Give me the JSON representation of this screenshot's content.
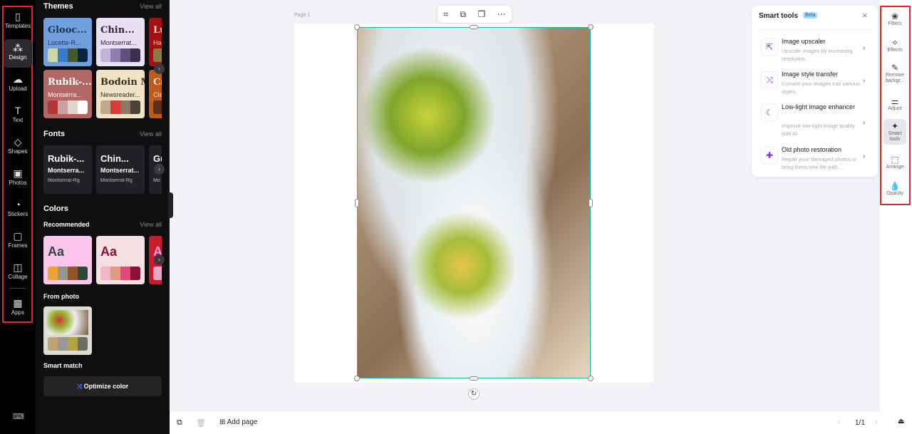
{
  "rail": {
    "items": [
      {
        "label": "Templates",
        "icon": "templates-icon"
      },
      {
        "label": "Design",
        "icon": "design-icon"
      },
      {
        "label": "Upload",
        "icon": "upload-icon"
      },
      {
        "label": "Text",
        "icon": "text-icon"
      },
      {
        "label": "Shapes",
        "icon": "shapes-icon"
      },
      {
        "label": "Photos",
        "icon": "photos-icon"
      },
      {
        "label": "Stickers",
        "icon": "stickers-icon"
      },
      {
        "label": "Frames",
        "icon": "frames-icon"
      },
      {
        "label": "Collage",
        "icon": "collage-icon"
      },
      {
        "label": "Apps",
        "icon": "apps-icon"
      }
    ],
    "selected": "Design"
  },
  "panel": {
    "themes": {
      "title": "Themes",
      "view_all": "View all",
      "cards": [
        {
          "t1": "Glooc...",
          "t2": "Lucette-R...",
          "bg": "#6fa0dd",
          "fg": "#1a3356",
          "colors": [
            "#cdd6a4",
            "#3a7acb",
            "#46592c",
            "#082441"
          ]
        },
        {
          "t1": "Chin...",
          "t2": "Montserrat...",
          "bg": "#e8e1f3",
          "fg": "#2e2543",
          "colors": [
            "#c0b4d8",
            "#8f7db0",
            "#5f4f7c",
            "#3a2f4e"
          ]
        },
        {
          "t1": "Lu",
          "t2": "Has",
          "bg": "#a50f12",
          "fg": "#f6d1c7",
          "colors": [
            "#8a7a44",
            "#a50f12",
            "#a50f12",
            "#a50f12"
          ]
        },
        {
          "t1": "Rubik-...",
          "t2": "Montserra...",
          "bg": "#b36866",
          "fg": "#fff",
          "colors": [
            "#b0363a",
            "#c9a2a2",
            "#e0d3d3",
            "#ffffff"
          ]
        },
        {
          "t1": "Bodoin Mo...",
          "t2": "Newsreader...",
          "bg": "#f1e3c5",
          "fg": "#3a2e25",
          "colors": [
            "#c4a68c",
            "#da3b3b",
            "#8b7763",
            "#4a4137"
          ]
        },
        {
          "t1": "Ca",
          "t2": "Cle",
          "bg": "#bd5a1c",
          "fg": "#f6d9c2",
          "colors": [
            "#55301a",
            "#55301a",
            "#55301a",
            "#55301a"
          ]
        }
      ]
    },
    "fonts": {
      "title": "Fonts",
      "view_all": "View all",
      "cards": [
        {
          "t1": "Rubik-...",
          "t2": "Montserra...",
          "t3": "Montserrat-Rg"
        },
        {
          "t1": "Chin...",
          "t2": "Montserrat...",
          "t3": "Montserrat-Rg"
        },
        {
          "t1": "Gu",
          "t2": "",
          "t3": "Mo"
        }
      ]
    },
    "colors": {
      "title": "Colors",
      "recommended": "Recommended",
      "view_all": "View all",
      "cards": [
        {
          "t1": "Aa",
          "bg": "#fcc6ec",
          "fg": "#2f4a3d",
          "colors": [
            "#f1a430",
            "#96968b",
            "#96542b",
            "#304a3a"
          ]
        },
        {
          "t1": "Aa",
          "bg": "#f4e0e3",
          "fg": "#8b0f3a",
          "colors": [
            "#f2b7c4",
            "#e59a80",
            "#e0487a",
            "#8b0f3a"
          ]
        },
        {
          "t1": "A",
          "bg": "#c91c2b",
          "fg": "#f9d",
          "colors": [
            "#e8a9c8",
            "#e8a9c8",
            "#e8a9c8",
            "#e8a9c8"
          ]
        }
      ],
      "from_photo": "From photo",
      "photo_colors": [
        "#bfa374",
        "#9a9796",
        "#b2a43f",
        "#6c6e66"
      ],
      "smart_match": "Smart match",
      "optimize": "Optimize color"
    }
  },
  "canvas": {
    "page_label": "Page 1"
  },
  "smart_tools": {
    "title": "Smart tools",
    "badge": "Beta",
    "items": [
      {
        "title": "Image upscaler",
        "desc": "Upscale images by increasing resolution.",
        "icon": "upscale-icon"
      },
      {
        "title": "Image style transfer",
        "desc": "Convert your images into various styles.",
        "icon": "style-transfer-icon"
      },
      {
        "title": "Low-light image enhancer",
        "desc": "Improve low-light image quality with AI.",
        "icon": "moon-icon"
      },
      {
        "title": "Old photo restoration",
        "desc": "Repair your damaged photos or bring them new life with...",
        "icon": "restore-icon"
      }
    ]
  },
  "right_rail": {
    "items": [
      {
        "label": "Filters"
      },
      {
        "label": "Effects"
      },
      {
        "label": "Remove backgr..."
      },
      {
        "label": "Adjust"
      },
      {
        "label": "Smart tools"
      },
      {
        "label": "Arrange"
      },
      {
        "label": "Opacity"
      }
    ],
    "selected": "Smart tools"
  },
  "bottom": {
    "add_page": "Add page",
    "page_indicator": "1/1"
  }
}
